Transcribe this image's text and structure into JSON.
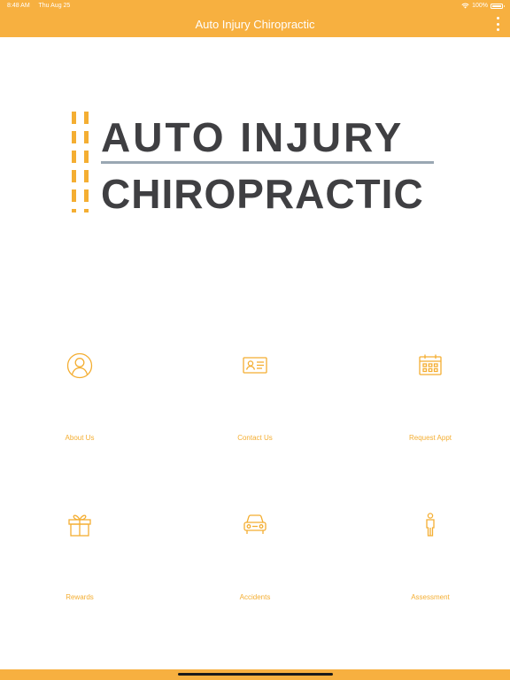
{
  "status_bar": {
    "time": "8:48 AM",
    "date": "Thu Aug 25",
    "battery": "100%",
    "wifi_icon": "wifi-icon",
    "battery_icon": "battery-icon"
  },
  "header": {
    "title": "Auto Injury Chiropractic",
    "menu_icon": "more-vertical-icon"
  },
  "logo": {
    "line1": "AUTO INJURY",
    "line2": "CHIROPRACTIC"
  },
  "tiles": [
    {
      "label": "About Us",
      "icon": "person-circle-icon"
    },
    {
      "label": "Contact Us",
      "icon": "contact-card-icon"
    },
    {
      "label": "Request Appt",
      "icon": "calendar-icon"
    },
    {
      "label": "Rewards",
      "icon": "gift-icon"
    },
    {
      "label": "Accidents",
      "icon": "car-icon"
    },
    {
      "label": "Assessment",
      "icon": "person-standing-icon"
    }
  ],
  "colors": {
    "brand": "#F7B040",
    "accent": "#F4AE32",
    "logo_text": "#3f3f42",
    "logo_rule": "#9aa7b3"
  }
}
